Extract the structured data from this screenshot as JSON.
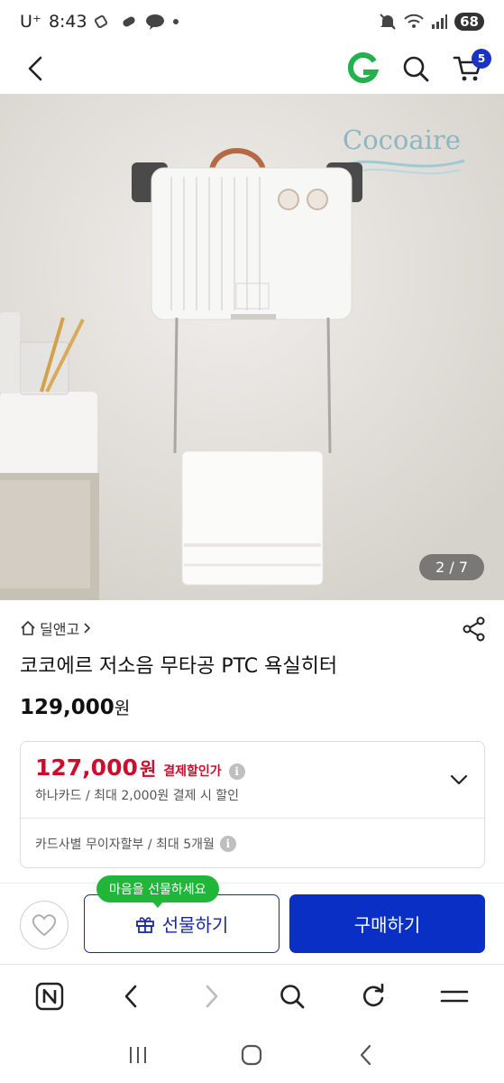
{
  "status_bar": {
    "carrier": "U⁺",
    "time": "8:43",
    "battery": "68"
  },
  "top_nav": {
    "cart_count": "5",
    "brand_color": "#1a33c7"
  },
  "product_image": {
    "brand_logo_text": "Cocoaire",
    "counter": "2 / 7"
  },
  "product": {
    "store_name": "딜앤고",
    "title": "코코에르 저소음 무타공 PTC 욕실히터",
    "price": "129,000",
    "price_unit": "원"
  },
  "card_discount": {
    "price": "127,000",
    "price_unit": "원",
    "label": "결제할인가",
    "detail": "하나카드 / 최대 2,000원 결제 시 할인",
    "installment": "카드사별 무이자할부 / 최대 5개월",
    "accent_color": "#c8102e"
  },
  "actions": {
    "gift_tooltip": "마음을 선물하세요",
    "gift_label": "선물하기",
    "buy_label": "구매하기",
    "buy_color": "#0a2fc4"
  },
  "browser_toolbar": {
    "icons": [
      "naver-n-icon",
      "back-icon",
      "forward-icon",
      "search-icon",
      "refresh-icon",
      "menu-icon"
    ]
  },
  "system_nav": {
    "icons": [
      "recent-apps-icon",
      "home-icon",
      "back-icon"
    ]
  }
}
